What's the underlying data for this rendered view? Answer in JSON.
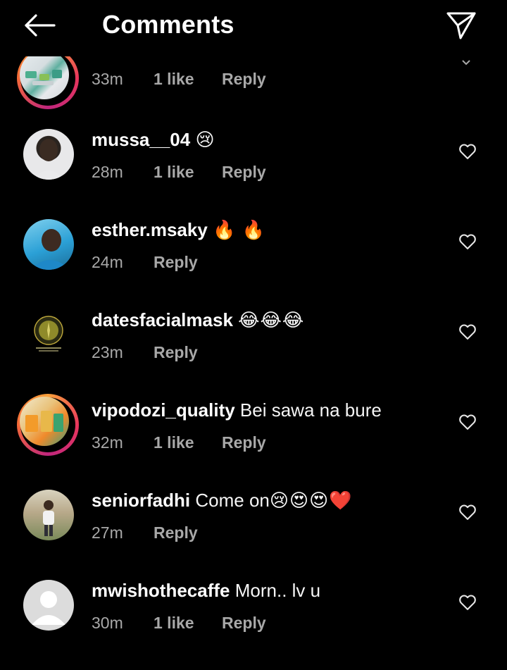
{
  "header": {
    "title": "Comments"
  },
  "comments": [
    {
      "username": "",
      "text": "",
      "time": "33m",
      "likes": "1 like",
      "reply": "Reply"
    },
    {
      "username": "mussa__04",
      "text": "",
      "emoji": "😢",
      "time": "28m",
      "likes": "1 like",
      "reply": "Reply"
    },
    {
      "username": "esther.msaky",
      "text": "",
      "emoji": "🔥 🔥",
      "time": "24m",
      "likes": "",
      "reply": "Reply"
    },
    {
      "username": "datesfacialmask",
      "text": "",
      "emoji": "😂😂😂",
      "time": "23m",
      "likes": "",
      "reply": "Reply"
    },
    {
      "username": "vipodozi_quality",
      "text": "Bei sawa na bure",
      "emoji": "",
      "time": "32m",
      "likes": "1 like",
      "reply": "Reply"
    },
    {
      "username": "seniorfadhi",
      "text": "Come on",
      "emoji": "😢😍😍❤️",
      "time": "27m",
      "likes": "",
      "reply": "Reply"
    },
    {
      "username": "mwishothecaffe",
      "text": "Morn.. lv u",
      "emoji": "",
      "time": "30m",
      "likes": "1 like",
      "reply": "Reply"
    }
  ],
  "colors": {
    "background": "#000000",
    "text_primary": "#f5f5f5",
    "text_secondary": "#a8a8a8",
    "story_ring": "#e8365d"
  },
  "icons": {
    "back": "arrow-left-icon",
    "send": "paper-plane-icon",
    "like": "heart-outline-icon",
    "collapse": "chevron-down-icon"
  }
}
